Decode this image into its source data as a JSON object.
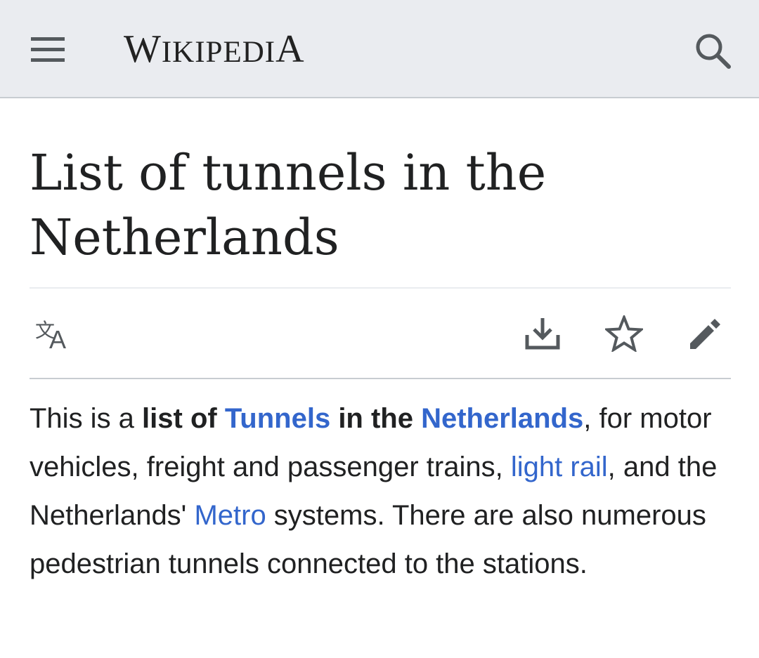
{
  "header": {
    "logo_first": "W",
    "logo_mid": "IKIPEDI",
    "logo_last": "A",
    "menu_icon": "hamburger-menu-icon",
    "search_icon": "search-icon",
    "background": "#eaecf0"
  },
  "article": {
    "title": "List of tunnels in the Netherlands",
    "actions": {
      "language_icon": "language-icon",
      "download_icon": "download-icon",
      "watch_icon": "star-icon",
      "edit_icon": "pencil-icon"
    },
    "intro": {
      "t1": "This is a ",
      "b1": "list of ",
      "link_tunnels": "Tunnels",
      "b2": " in the ",
      "link_netherlands": "Netherlands",
      "t2": ", for motor vehicles, freight and passenger trains, ",
      "link_light_rail": "light rail",
      "t3": ", and the Netherlands' ",
      "link_metro": "Metro",
      "t4": " systems. There are also numerous pedestrian tunnels connected to the stations."
    }
  },
  "colors": {
    "link": "#3366cc",
    "text": "#202122",
    "divider": "#c8ccd1"
  }
}
